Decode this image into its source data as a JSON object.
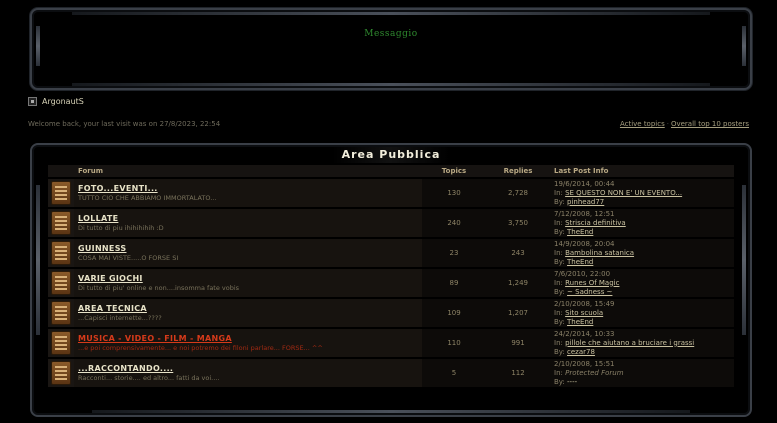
{
  "message_box": {
    "title": "Messaggio"
  },
  "user": {
    "name": "ArgonautS"
  },
  "welcome_text": "Welcome back, your last visit was on 27/8/2023, 22:54",
  "top_links": {
    "active": "Active topics",
    "separator": "·",
    "posters": "Overall top 10 posters"
  },
  "section": {
    "title": "Area Pubblica",
    "columns": {
      "forum": "Forum",
      "topics": "Topics",
      "replies": "Replies",
      "last": "Last Post Info"
    }
  },
  "forums": [
    {
      "name": "FOTO...EVENTI...",
      "desc": "TUTTO CIO CHE ABBIAMO IMMORTALATO...",
      "topics": "130",
      "replies": "2,728",
      "date": "19/6/2014, 00:44",
      "in_label": "In:",
      "topic": "SE QUESTO NON E' UN EVENTO...",
      "by_label": "By:",
      "by": "pinhead77",
      "hot": false
    },
    {
      "name": "LOLLATE",
      "desc": "Di tutto di piu ihihihihih :D",
      "topics": "240",
      "replies": "3,750",
      "date": "7/12/2008, 12:51",
      "in_label": "In:",
      "topic": "Striscia definitiva",
      "by_label": "By:",
      "by": "TheEnd",
      "hot": false
    },
    {
      "name": "GUINNESS",
      "desc": "COSA MAI VISTE.....O FORSE SI",
      "topics": "23",
      "replies": "243",
      "date": "14/9/2008, 20:04",
      "in_label": "In:",
      "topic": "Bambolina satanica",
      "by_label": "By:",
      "by": "TheEnd",
      "hot": false
    },
    {
      "name": "VARIE GIOCHI",
      "desc": "Di tutto di piu' online e non....insomma fate vobis",
      "topics": "89",
      "replies": "1,249",
      "date": "7/6/2010, 22:00",
      "in_label": "In:",
      "topic": "Runes Of Magic",
      "by_label": "By:",
      "by": "~ Sadness ~",
      "hot": false
    },
    {
      "name": "AREA TECNICA",
      "desc": "...Capisci internette...????",
      "topics": "109",
      "replies": "1,207",
      "date": "2/10/2008, 15:49",
      "in_label": "In:",
      "topic": "Sito scuola",
      "by_label": "By:",
      "by": "TheEnd",
      "hot": false
    },
    {
      "name": "MUSICA - VIDEO - FILM - MANGA",
      "desc": "...e poi comprensivamente... e noi potremo dei filoni parlare... FORSE... ^^",
      "topics": "110",
      "replies": "991",
      "date": "24/2/2014, 10:33",
      "in_label": "In:",
      "topic": "pillole che aiutano a bruciare i grassi",
      "by_label": "By:",
      "by": "cezar78",
      "hot": true
    },
    {
      "name": "...RACCONTANDO....",
      "desc": "Racconti... storie.... ed altro... fatti da voi....",
      "topics": "5",
      "replies": "112",
      "date": "2/10/2008, 15:51",
      "in_label": "In:",
      "topic": "Protected Forum",
      "by_label": "By:",
      "by": "----",
      "hot": false,
      "topic_protected": true
    }
  ],
  "colors": {
    "hot_forum": "#d63a1a",
    "message_title": "#2f8a2f",
    "background": "#000000"
  }
}
